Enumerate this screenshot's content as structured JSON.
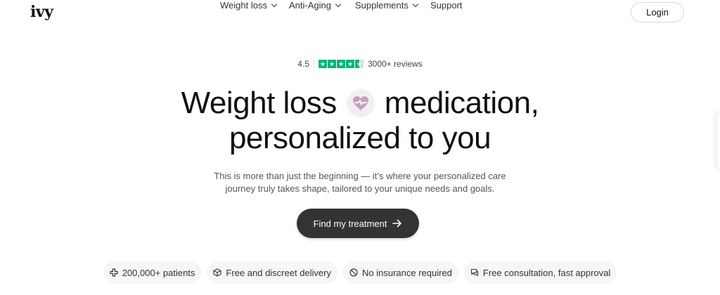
{
  "header": {
    "logo": "ivy",
    "nav": [
      {
        "label": "Weight loss",
        "has_dropdown": true
      },
      {
        "label": "Anti-Aging",
        "has_dropdown": true
      },
      {
        "label": "Supplements",
        "has_dropdown": true
      },
      {
        "label": "Support",
        "has_dropdown": false
      }
    ],
    "login_label": "Login"
  },
  "rating": {
    "score": "4.5",
    "stars": 4.5,
    "reviews": "3000+ reviews",
    "star_color": "#00b67a"
  },
  "hero": {
    "headline_part1": "Weight loss",
    "headline_part2": "medication,",
    "headline_line2": "personalized to you",
    "badge_icon": "heartbeat-icon",
    "subtext_line1": "This is more than just the beginning — it’s where your personalized care",
    "subtext_line2": "journey truly takes shape, tailored to your unique needs and goals.",
    "cta_label": "Find my treatment",
    "cta_icon": "arrow-right-icon"
  },
  "features": [
    {
      "icon": "medical-cross-icon",
      "label": "200,000+ patients"
    },
    {
      "icon": "box-icon",
      "label": "Free and discreet delivery"
    },
    {
      "icon": "no-sign-icon",
      "label": "No insurance required"
    },
    {
      "icon": "chat-icon",
      "label": "Free consultation, fast approval"
    }
  ]
}
